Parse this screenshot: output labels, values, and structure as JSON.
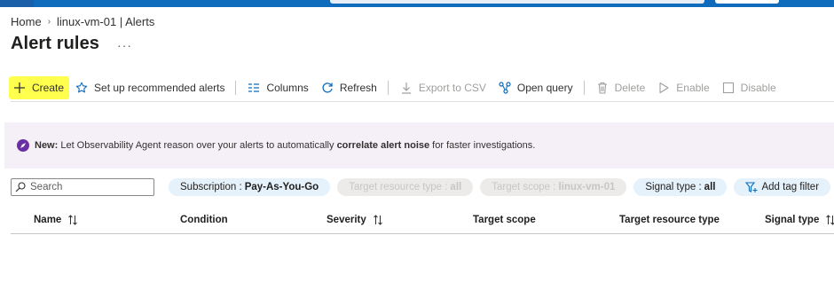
{
  "breadcrumb": {
    "home": "Home",
    "current": "linux-vm-01 | Alerts"
  },
  "page": {
    "title": "Alert rules",
    "more": "···"
  },
  "toolbar": {
    "create": "Create",
    "recommended": "Set up recommended alerts",
    "columns": "Columns",
    "refresh": "Refresh",
    "export": "Export to CSV",
    "open_query": "Open query",
    "delete": "Delete",
    "enable": "Enable",
    "disable": "Disable"
  },
  "banner": {
    "lead": "New:",
    "text1": " Let Observability Agent reason over your alerts to automatically ",
    "bold": "correlate alert noise",
    "text2": " for faster investigations."
  },
  "filters": {
    "search_placeholder": "Search",
    "subscription_label": "Subscription : ",
    "subscription_value": "Pay-As-You-Go",
    "resource_type_label": "Target resource type : ",
    "resource_type_value": "all",
    "scope_label": "Target scope : ",
    "scope_value": "linux-vm-01",
    "signal_label": "Signal type : ",
    "signal_value": "all",
    "add_tag": "Add tag filter"
  },
  "table": {
    "columns": [
      "Name",
      "Condition",
      "Severity",
      "Target scope",
      "Target resource type",
      "Signal type"
    ]
  },
  "colors": {
    "accent": "#0f6cbd",
    "highlight": "#ffff4d",
    "banner_bg": "#f5f0f8",
    "pill_bg": "#e5f1fb"
  }
}
